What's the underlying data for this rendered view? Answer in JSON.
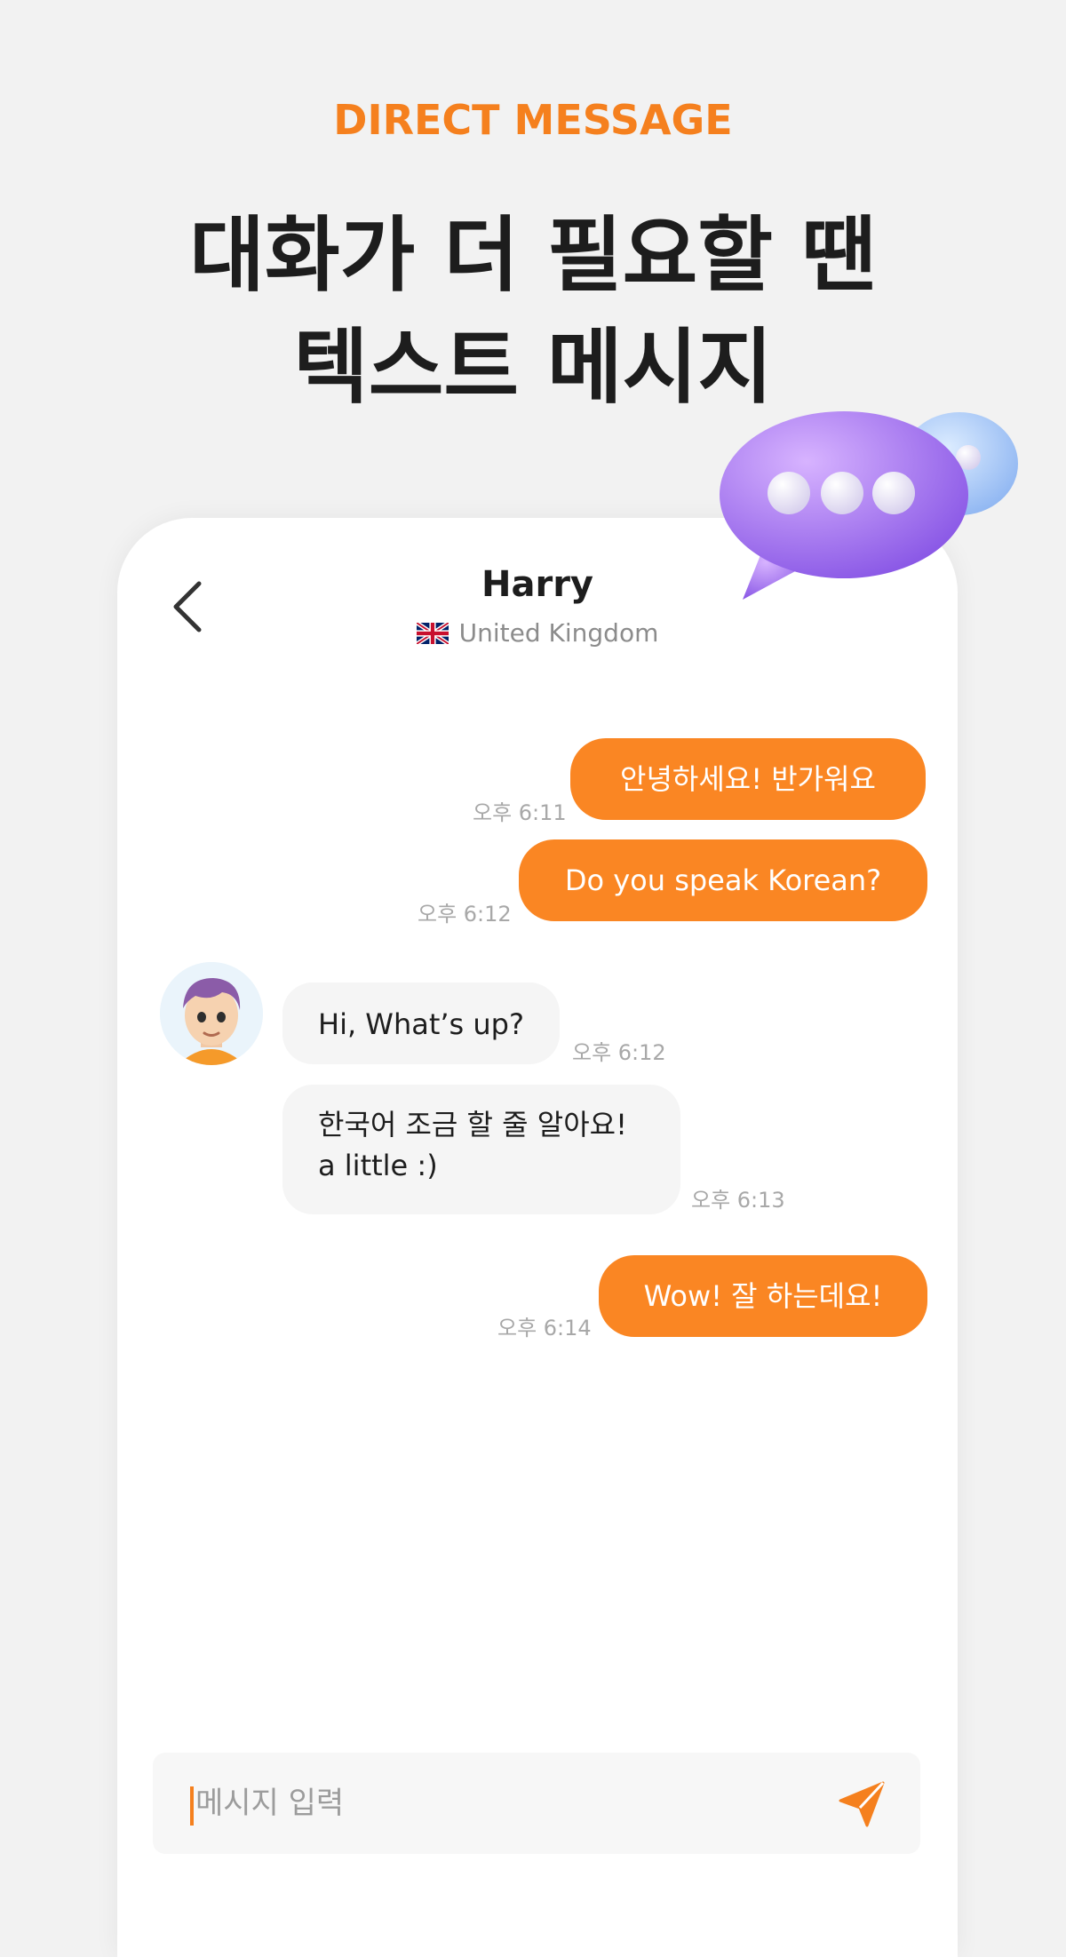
{
  "promo": {
    "eyebrow": "DIRECT MESSAGE",
    "headline_line1": "대화가 더 필요할 땐",
    "headline_line2": "텍스트 메시지"
  },
  "chat": {
    "title": "Harry",
    "country": "United Kingdom",
    "messages": [
      {
        "sender": "me",
        "text": "안녕하세요! 반가워요",
        "time": "오후 6:11"
      },
      {
        "sender": "me",
        "text": "Do you speak Korean?",
        "time": "오후 6:12"
      },
      {
        "sender": "them",
        "text": "Hi, What’s up?",
        "time": "오후 6:12"
      },
      {
        "sender": "them",
        "text_line1": "한국어 조금 할 줄 알아요!",
        "text_line2": "a little :)",
        "time": "오후 6:13"
      },
      {
        "sender": "me",
        "text": "Wow! 잘 하는데요!",
        "time": "오후 6:14"
      }
    ]
  },
  "input": {
    "placeholder": "메시지 입력"
  },
  "colors": {
    "accent": "#f5801e",
    "bubble_me": "#fa8623",
    "bubble_them": "#f5f5f5",
    "background": "#f2f2f2"
  },
  "icons": {
    "back": "chevron-left-icon",
    "flag": "uk-flag-icon",
    "send": "send-icon"
  }
}
